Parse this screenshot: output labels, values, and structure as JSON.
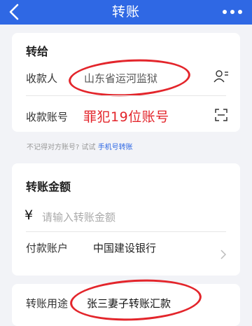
{
  "header": {
    "title": "转账",
    "back_icon": "chevron-left-icon",
    "more_icon": "more-dots-icon",
    "background": "#2f68e4"
  },
  "recipient_section": {
    "title": "转给",
    "payee_label": "收款人",
    "payee_value": "山东省运河监狱",
    "payee_icon": "contact-person-icon",
    "account_label": "收款账号",
    "account_value": "罪犯19位账号",
    "account_icon": "scan-icon",
    "annotation_color": "#e3252b"
  },
  "hint": {
    "text": "不记得对方账号? 试试",
    "link": "手机号转账"
  },
  "amount_section": {
    "title": "转账金额",
    "currency_symbol": "¥",
    "amount_placeholder": "请输入转账金额",
    "pay_account_label": "付款账户",
    "pay_account_value": "中国建设银行"
  },
  "purpose_section": {
    "label": "转账用途",
    "value": "张三妻子转账汇款"
  }
}
